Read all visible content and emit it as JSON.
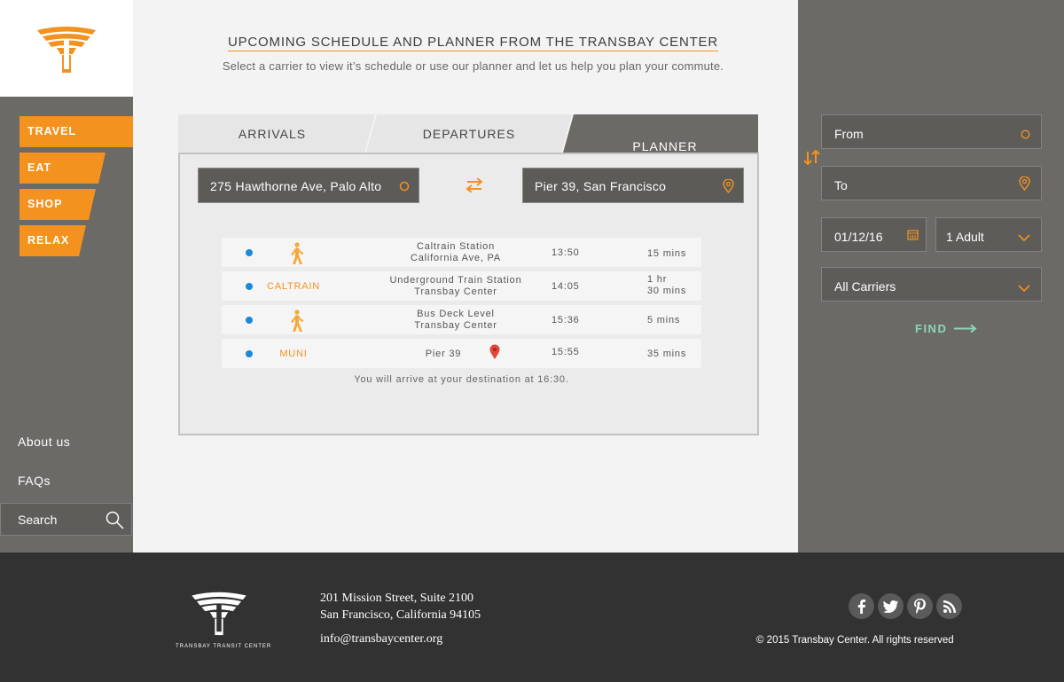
{
  "brand": {
    "accent": "#f4921f",
    "footer_logo_text": "TRANSBAY TRANSIT CENTER"
  },
  "sidebar": {
    "nav": [
      {
        "label": "TRAVEL"
      },
      {
        "label": "EAT"
      },
      {
        "label": "SHOP"
      },
      {
        "label": "RELAX"
      }
    ],
    "links": {
      "about": "About us",
      "faqs": "FAQs"
    },
    "search_placeholder": "Search"
  },
  "main": {
    "title": "UPCOMING SCHEDULE AND PLANNER FROM THE TRANSBAY CENTER",
    "subtitle": "Select a carrier to view it’s schedule or use our planner and let us help you plan your commute.",
    "tabs": [
      {
        "label": "ARRIVALS",
        "active": false
      },
      {
        "label": "DEPARTURES",
        "active": false
      },
      {
        "label": "PLANNER",
        "active": true
      }
    ],
    "planner": {
      "origin": "275 Hawthorne Ave, Palo Alto",
      "destination": "Pier 39, San Francisco",
      "steps": [
        {
          "mode": "walk-icon",
          "carrier": "",
          "station_line1": "Caltrain Station",
          "station_line2": "California Ave, PA",
          "time": "13:50",
          "duration_line1": "15 mins",
          "duration_line2": ""
        },
        {
          "mode": "",
          "carrier": "CALTRAIN",
          "station_line1": "Underground Train Station",
          "station_line2": "Transbay Center",
          "time": "14:05",
          "duration_line1": "1 hr",
          "duration_line2": "30 mins"
        },
        {
          "mode": "walk-icon",
          "carrier": "",
          "station_line1": "Bus Deck Level",
          "station_line2": "Transbay Center",
          "time": "15:36",
          "duration_line1": "5 mins",
          "duration_line2": ""
        },
        {
          "mode": "",
          "carrier": "MUNI",
          "station_line1": "Pier 39",
          "station_line2": "",
          "time": "15:55",
          "duration_line1": "35 mins",
          "duration_line2": ""
        }
      ],
      "arrival_note": "You will arrive at your destination at 16:30."
    }
  },
  "right_panel": {
    "from_label": "From",
    "to_label": "To",
    "date": "01/12/16",
    "passengers": "1 Adult",
    "carrier": "All Carriers",
    "find_label": "FIND"
  },
  "footer": {
    "address_line1": "201 Mission Street, Suite 2100",
    "address_line2": "San Francisco, California 94105",
    "email": "info@transbaycenter.org",
    "copyright": "© 2015 Transbay Center. All rights reserved",
    "socials": [
      "facebook-icon",
      "twitter-icon",
      "pinterest-icon",
      "rss-icon"
    ]
  }
}
